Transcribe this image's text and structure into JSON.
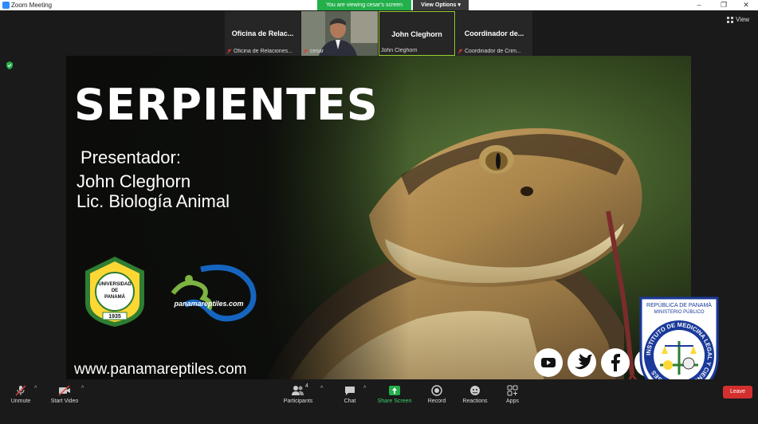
{
  "window": {
    "title": "Zoom Meeting",
    "share_banner": "You are viewing cesar's screen",
    "view_options": "View Options",
    "view_button": "View"
  },
  "participants": [
    {
      "name": "Oficina de Relac...",
      "label": "Oficina de Relaciones..."
    },
    {
      "name": "",
      "label": "cesar"
    },
    {
      "name": "John Cleghorn",
      "label": "John Cleghorn"
    },
    {
      "name": "Coordinador de...",
      "label": "Coordinador de Crim..."
    }
  ],
  "slide": {
    "title": "SERPIENTES",
    "presenter_label": "Presentador:",
    "presenter_name": "John Cleghorn",
    "presenter_degree": "Lic. Biología Animal",
    "website": "www.panamareptiles.com",
    "university_logo": {
      "line1": "UNIVERSIDAD",
      "line2": "DE",
      "line3": "PANAMÁ",
      "year": "1935"
    },
    "panamareptiles_logo": "panamareptiles.com",
    "institute_logo": {
      "line1": "REPÚBLICA DE PANAMÁ",
      "line2": "MINISTERIO PÚBLICO",
      "ring": "INSTITUTO DE MEDICINA LEGAL Y CIENCIAS FORENSES"
    },
    "social_icons": [
      "youtube-icon",
      "twitter-icon",
      "facebook-icon",
      "instagram-icon"
    ]
  },
  "toolbar": {
    "unmute": "Unmute",
    "start_video": "Start Video",
    "participants": "Participants",
    "participants_count": "4",
    "chat": "Chat",
    "share_screen": "Share Screen",
    "record": "Record",
    "reactions": "Reactions",
    "apps": "Apps",
    "leave": "Leave"
  },
  "colors": {
    "share_green": "#23b04b",
    "leave_red": "#d32f2f",
    "zoom_blue": "#2d8cff"
  }
}
